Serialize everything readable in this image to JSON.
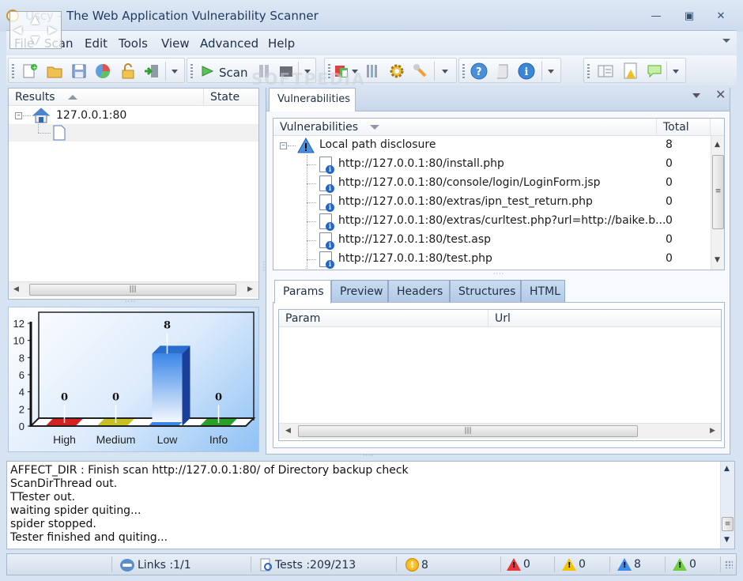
{
  "window": {
    "title": "Uscy - The Web Application Vulnerability Scanner",
    "title_visible": "The Web Application Vulnerability Scanner",
    "controls": [
      "minimize",
      "maximize",
      "close"
    ]
  },
  "menu": {
    "items": [
      {
        "label": "File"
      },
      {
        "label": "Scan"
      },
      {
        "label": "Edit"
      },
      {
        "label": "Tools"
      },
      {
        "label": "View"
      },
      {
        "label": "Advanced"
      },
      {
        "label": "Help"
      }
    ]
  },
  "toolbar": {
    "scan_label": "Scan",
    "icons": [
      "new-icon",
      "open-folder-icon",
      "save-icon",
      "report-chart-icon",
      "lock-icon",
      "import-icon",
      "play-icon",
      "pause-icon",
      "stop-icon",
      "plugins-icon",
      "tools-icon",
      "settings-gear-icon",
      "wrench-icon",
      "help-icon",
      "script-icon",
      "info-icon",
      "layout-icon",
      "warning-doc-icon",
      "comment-icon"
    ]
  },
  "watermark": "SOFTPEDIA",
  "results": {
    "headers": {
      "results": "Results",
      "state": "State"
    },
    "tree": [
      {
        "label": "127.0.0.1:80",
        "icon": "house-icon",
        "expanded": true
      },
      {
        "label": "",
        "icon": "document-icon"
      }
    ]
  },
  "chart_data": {
    "type": "bar",
    "title": "",
    "categories": [
      "High",
      "Medium",
      "Low",
      "Info"
    ],
    "values": [
      0,
      0,
      8,
      0
    ],
    "colors": [
      "#d42020",
      "#c8c020",
      "#3a86e8",
      "#28a028"
    ],
    "xlabel": "",
    "ylabel": "",
    "ylim": [
      0,
      12
    ],
    "yticks": [
      0,
      2,
      4,
      6,
      8,
      10,
      12
    ],
    "grid": false,
    "legend": "none"
  },
  "vulnerabilities_panel": {
    "tab_label": "Vulnerabilities",
    "headers": {
      "name": "Vulnerabilities",
      "total": "Total"
    },
    "group": {
      "label": "Local path disclosure",
      "total": "8",
      "icon": "warning-icon"
    },
    "items": [
      {
        "url": "http://127.0.0.1:80/install.php",
        "total": "0"
      },
      {
        "url": "http://127.0.0.1:80/console/login/LoginForm.jsp",
        "total": "0"
      },
      {
        "url": "http://127.0.0.1:80/extras/ipn_test_return.php",
        "total": "0"
      },
      {
        "url": "http://127.0.0.1:80/extras/curltest.php?url=http://baike.b...",
        "total": "0"
      },
      {
        "url": "http://127.0.0.1:80/test.asp",
        "total": "0"
      },
      {
        "url": "http://127.0.0.1:80/test.php",
        "total": "0"
      }
    ]
  },
  "detail": {
    "tabs": [
      {
        "label": "Params",
        "active": true
      },
      {
        "label": "Preview"
      },
      {
        "label": "Headers"
      },
      {
        "label": "Structures"
      },
      {
        "label": "HTML"
      }
    ],
    "headers": {
      "param": "Param",
      "url": "Url"
    }
  },
  "log": {
    "lines": [
      "AFFECT_DIR : Finish scan http://127.0.0.1:80/ of Directory backup check",
      "ScanDirThread out.",
      "TTester out.",
      "waiting spider quiting...",
      "spider stopped.",
      "Tester finished and quiting..."
    ]
  },
  "status": {
    "links": "Links :1/1",
    "tests": "Tests :209/213",
    "alerts_total": "8",
    "high": "0",
    "medium": "0",
    "low": "8",
    "info": "0",
    "colors": {
      "high": "#e8363a",
      "medium": "#f5c400",
      "low": "#3c8ee8",
      "info": "#6ccf3c",
      "alerts": "#f5b800"
    }
  }
}
